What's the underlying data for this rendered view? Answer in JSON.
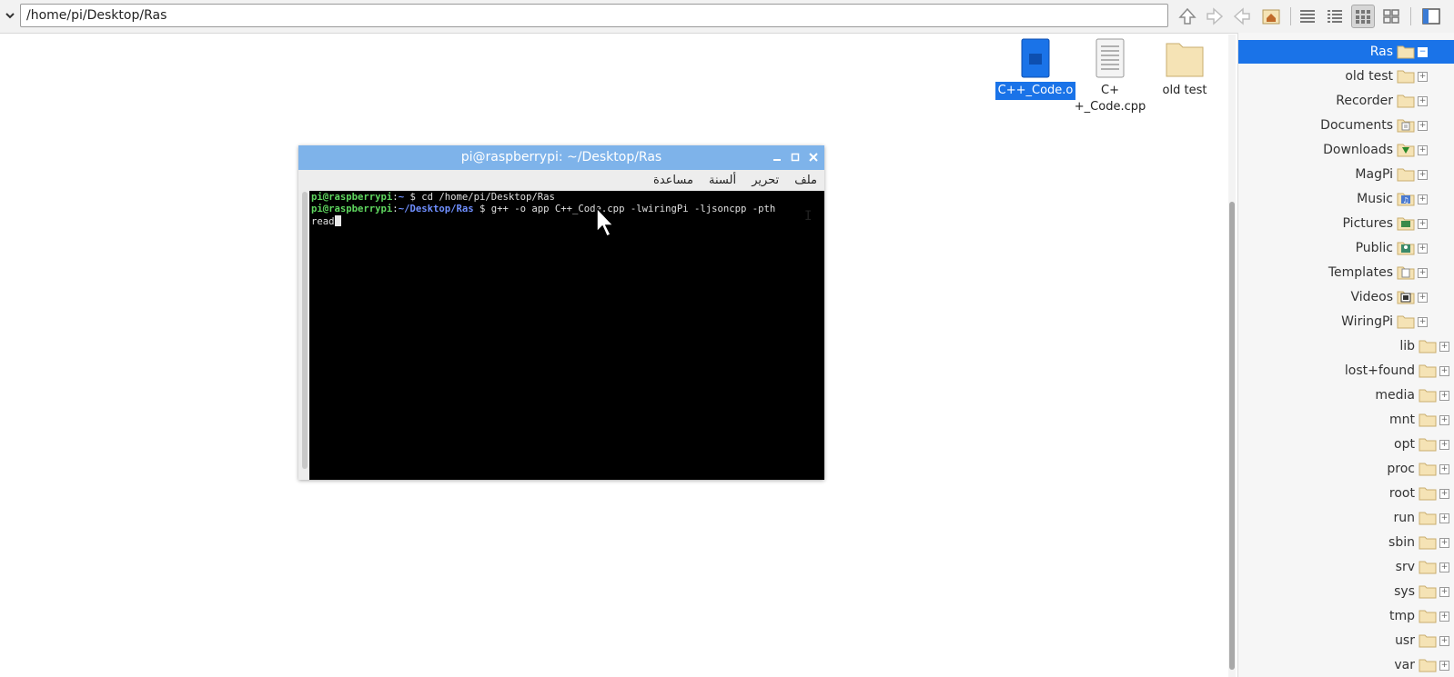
{
  "address_bar": {
    "path": "/home/pi/Desktop/Ras"
  },
  "desktop_icons": [
    {
      "label": "C++_Code.o",
      "selected": true
    },
    {
      "label": "C+\n+_Code.cpp",
      "selected": false
    },
    {
      "label": "old test",
      "selected": false
    }
  ],
  "terminal": {
    "title": "pi@raspberrypi: ~/Desktop/Ras",
    "menu": [
      "ملف",
      "تحرير",
      "ألسنة",
      "مساعدة"
    ],
    "lines": [
      {
        "user": "pi@raspberrypi",
        "sep": ":",
        "path": "~",
        "prompt": " $ ",
        "cmd": "cd /home/pi/Desktop/Ras"
      },
      {
        "user": "pi@raspberrypi",
        "sep": ":",
        "path": "~/Desktop/Ras",
        "prompt": " $ ",
        "cmd": "g++ -o app C++_Code.cpp -lwiringPi -ljsoncpp -pth"
      }
    ],
    "wrap": "read"
  },
  "sidebar": {
    "items": [
      {
        "label": "Ras",
        "icon": "folder-icon",
        "expander": "−",
        "selected": true
      },
      {
        "label": "old test",
        "icon": "folder-icon",
        "expander": "+"
      },
      {
        "label": "Recorder",
        "icon": "folder-icon",
        "expander": "+"
      },
      {
        "label": "Documents",
        "icon": "documents-folder-icon",
        "expander": "+"
      },
      {
        "label": "Downloads",
        "icon": "downloads-folder-icon",
        "expander": "+"
      },
      {
        "label": "MagPi",
        "icon": "folder-icon",
        "expander": "+"
      },
      {
        "label": "Music",
        "icon": "music-folder-icon",
        "expander": "+"
      },
      {
        "label": "Pictures",
        "icon": "pictures-folder-icon",
        "expander": "+"
      },
      {
        "label": "Public",
        "icon": "public-folder-icon",
        "expander": "+"
      },
      {
        "label": "Templates",
        "icon": "templates-folder-icon",
        "expander": "+"
      },
      {
        "label": "Videos",
        "icon": "videos-folder-icon",
        "expander": "+"
      },
      {
        "label": "WiringPi",
        "icon": "folder-icon",
        "expander": "+"
      },
      {
        "label": "lib",
        "icon": "folder-icon",
        "expander": "+"
      },
      {
        "label": "lost+found",
        "icon": "folder-icon",
        "expander": "+"
      },
      {
        "label": "media",
        "icon": "folder-icon",
        "expander": "+"
      },
      {
        "label": "mnt",
        "icon": "folder-icon",
        "expander": "+"
      },
      {
        "label": "opt",
        "icon": "folder-icon",
        "expander": "+"
      },
      {
        "label": "proc",
        "icon": "folder-icon",
        "expander": "+"
      },
      {
        "label": "root",
        "icon": "folder-icon",
        "expander": "+"
      },
      {
        "label": "run",
        "icon": "folder-icon",
        "expander": "+"
      },
      {
        "label": "sbin",
        "icon": "folder-icon",
        "expander": "+"
      },
      {
        "label": "srv",
        "icon": "folder-icon",
        "expander": "+"
      },
      {
        "label": "sys",
        "icon": "folder-icon",
        "expander": "+"
      },
      {
        "label": "tmp",
        "icon": "folder-icon",
        "expander": "+"
      },
      {
        "label": "usr",
        "icon": "folder-icon",
        "expander": "+"
      },
      {
        "label": "var",
        "icon": "folder-icon",
        "expander": "+"
      }
    ]
  },
  "colors": {
    "selection": "#1a73e8",
    "terminal_title": "#7eb3ea",
    "folder": "#f5e3b5"
  }
}
